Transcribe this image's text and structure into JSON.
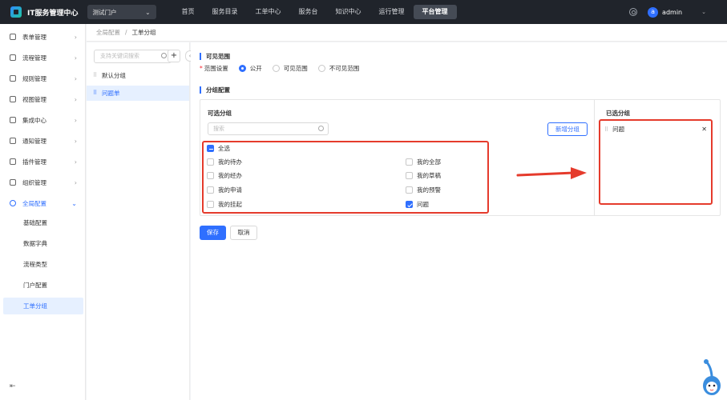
{
  "app": {
    "title": "IT服务管理中心",
    "portal": "测试门户",
    "user": "admin",
    "avatar_letter": "a"
  },
  "nav": [
    "首页",
    "服务目录",
    "工单中心",
    "服务台",
    "知识中心",
    "运行管理",
    "平台管理"
  ],
  "nav_active": "平台管理",
  "sidebar": {
    "items": [
      {
        "label": "表单管理",
        "icon": "form-icon"
      },
      {
        "label": "流程管理",
        "icon": "flow-icon"
      },
      {
        "label": "规则管理",
        "icon": "rule-icon"
      },
      {
        "label": "视图管理",
        "icon": "view-icon"
      },
      {
        "label": "集成中心",
        "icon": "integration-icon"
      },
      {
        "label": "通知管理",
        "icon": "bell-icon"
      },
      {
        "label": "插件管理",
        "icon": "plugin-icon"
      },
      {
        "label": "组织管理",
        "icon": "org-icon"
      },
      {
        "label": "全局配置",
        "icon": "settings-icon"
      }
    ],
    "sub_items": [
      "基础配置",
      "数据字典",
      "流程类型",
      "门户配置",
      "工单分组"
    ],
    "active_sub": "工单分组"
  },
  "breadcrumb": {
    "parent": "全局配置",
    "separator": "/",
    "current": "工单分组"
  },
  "groups": {
    "search_placeholder": "支持关键词搜索",
    "items": [
      "默认分组",
      "问题单"
    ],
    "active": "问题单"
  },
  "visibility": {
    "title": "可见范围",
    "label": "范围设置",
    "options": [
      "公开",
      "可见范围",
      "不可见范围"
    ],
    "selected": "公开"
  },
  "group_config": {
    "title": "分组配置",
    "available_title": "可选分组",
    "search_placeholder": "搜索",
    "new_group_label": "新增分组",
    "select_all_label": "全选",
    "options": [
      {
        "label": "我的待办",
        "checked": false
      },
      {
        "label": "我的全部",
        "checked": false
      },
      {
        "label": "我的经办",
        "checked": false
      },
      {
        "label": "我的草稿",
        "checked": false
      },
      {
        "label": "我的申请",
        "checked": false
      },
      {
        "label": "我的预警",
        "checked": false
      },
      {
        "label": "我的挂起",
        "checked": false
      },
      {
        "label": "问题",
        "checked": true
      }
    ],
    "selected_title": "已选分组",
    "selected_items": [
      "问题"
    ]
  },
  "actions": {
    "save": "保存",
    "cancel": "取消"
  }
}
